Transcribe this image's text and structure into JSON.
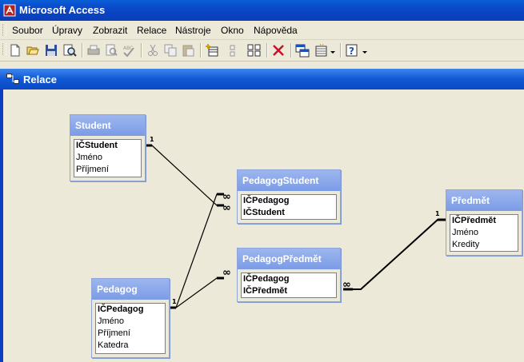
{
  "app": {
    "title": "Microsoft Access"
  },
  "menu": [
    "Soubor",
    "Úpravy",
    "Zobrazit",
    "Relace",
    "Nástroje",
    "Okno",
    "Nápověda"
  ],
  "toolbar": {
    "icons": [
      "new-icon",
      "open-icon",
      "save-icon",
      "search-icon",
      "print-icon",
      "print-preview-icon",
      "spelling-icon",
      "cut-icon",
      "copy-icon",
      "paste-icon",
      "show-table-icon",
      "show-direct-icon",
      "show-all-icon",
      "delete-icon",
      "relationships-icon",
      "new-object-icon",
      "help-icon"
    ]
  },
  "child_window": {
    "title": "Relace"
  },
  "tables": {
    "student": {
      "name": "Student",
      "fields": [
        "IČStudent",
        "Jméno",
        "Příjmení"
      ]
    },
    "pedagog_student": {
      "name": "PedagogStudent",
      "fields": [
        "IČPedagog",
        "IČStudent"
      ]
    },
    "pedagog_predmet": {
      "name": "PedagogPředmět",
      "fields": [
        "IČPedagog",
        "IČPředmět"
      ]
    },
    "predmet": {
      "name": "Předmět",
      "fields": [
        "IČPředmět",
        "Jméno",
        "Kredity"
      ]
    },
    "pedagog": {
      "name": "Pedagog",
      "fields": [
        "IČPedagog",
        "Jméno",
        "Příjmení",
        "Katedra"
      ]
    }
  },
  "relationship_labels": {
    "one": "1",
    "many": "∞"
  }
}
